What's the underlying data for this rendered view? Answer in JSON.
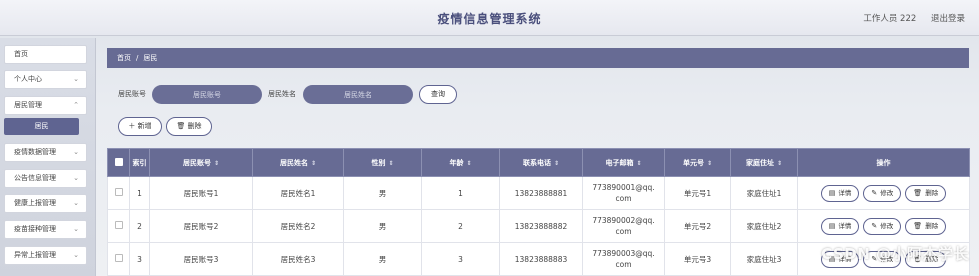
{
  "header": {
    "title": "疫情信息管理系统",
    "user": "工作人员 222",
    "logout": "退出登录"
  },
  "sidebar": {
    "items": [
      {
        "label": "首页",
        "has_chevron": false
      },
      {
        "label": "个人中心",
        "has_chevron": true
      },
      {
        "label": "居民管理",
        "has_chevron": true
      },
      {
        "label": "疫情数据管理",
        "has_chevron": true
      },
      {
        "label": "公告信息管理",
        "has_chevron": true
      },
      {
        "label": "健康上报管理",
        "has_chevron": true
      },
      {
        "label": "疫苗接种管理",
        "has_chevron": true
      },
      {
        "label": "异常上报管理",
        "has_chevron": true
      }
    ],
    "active_sub": "居民"
  },
  "breadcrumb": {
    "home": "首页",
    "sep": "/",
    "current": "居民"
  },
  "search": {
    "label1": "居民账号",
    "placeholder1": "居民账号",
    "label2": "居民姓名",
    "placeholder2": "居民姓名",
    "query_btn": "查询"
  },
  "actions": {
    "add": "新增",
    "delete": "删除"
  },
  "table": {
    "headers": [
      "索引",
      "居民账号",
      "居民姓名",
      "性别",
      "年龄",
      "联系电话",
      "电子邮箱",
      "单元号",
      "家庭住址",
      "操作"
    ],
    "rows": [
      {
        "index": "1",
        "account": "居民账号1",
        "name": "居民姓名1",
        "gender": "男",
        "age": "1",
        "phone": "13823888881",
        "email": "773890001@qq.com",
        "unit": "单元号1",
        "address": "家庭住址1"
      },
      {
        "index": "2",
        "account": "居民账号2",
        "name": "居民姓名2",
        "gender": "男",
        "age": "2",
        "phone": "13823888882",
        "email": "773890002@qq.com",
        "unit": "单元号2",
        "address": "家庭住址2"
      },
      {
        "index": "3",
        "account": "居民账号3",
        "name": "居民姓名3",
        "gender": "男",
        "age": "3",
        "phone": "13823888883",
        "email": "773890003@qq.com",
        "unit": "单元号3",
        "address": "家庭住址3"
      }
    ],
    "row_actions": {
      "detail": "详情",
      "edit": "修改",
      "delete": "删除"
    }
  },
  "watermark": "CSDN @小阿杰学长",
  "colors": {
    "accent": "#676b94",
    "active": "#5f6491"
  }
}
